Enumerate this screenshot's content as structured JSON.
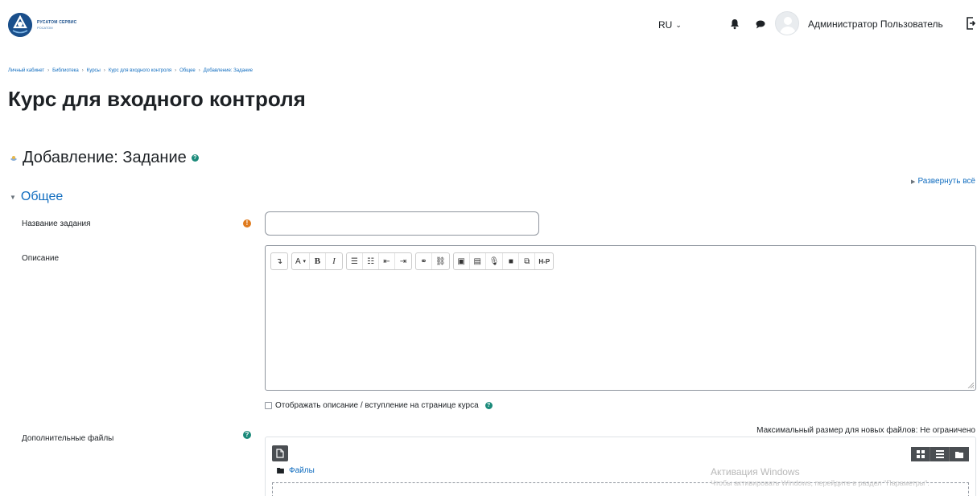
{
  "header": {
    "logo": {
      "line1": "РУСАТОМ СЕРВИС",
      "line2": "РОСАТОМ"
    },
    "language": "RU",
    "user_name": "Администратор Пользователь",
    "icons": [
      "bell-icon",
      "chat-icon",
      "logout-icon"
    ]
  },
  "breadcrumb": [
    "Личный кабинет",
    "Библиотека",
    "Курсы",
    "Курс для входного контроля",
    "Общее",
    "Добавление: Задание"
  ],
  "page_title": "Курс для входного контроля",
  "section_heading": "Добавление: Задание",
  "expand_all": "Развернуть всё",
  "fieldset": {
    "legend": "Общее"
  },
  "form": {
    "name_label": "Название задания",
    "name_value": "",
    "description_label": "Описание",
    "show_description_label": "Отображать описание / вступление на странице курса",
    "show_description_checked": false,
    "attachments_label": "Дополнительные файлы",
    "max_size_text": "Максимальный размер для новых файлов: Не ограничено",
    "files_folder": "Файлы"
  },
  "editor_toolbar": {
    "bold": "B",
    "italic": "I",
    "font": "A",
    "h5p": "H-P"
  },
  "watermark": {
    "title": "Активация Windows",
    "subtitle": "Чтобы активировать Windows, перейдите в раздел \"Параметры\"."
  },
  "colors": {
    "link": "#0f6cbf",
    "required": "#e07b1e",
    "help": "#1b8a7a",
    "dark_button": "#4a4e52"
  }
}
